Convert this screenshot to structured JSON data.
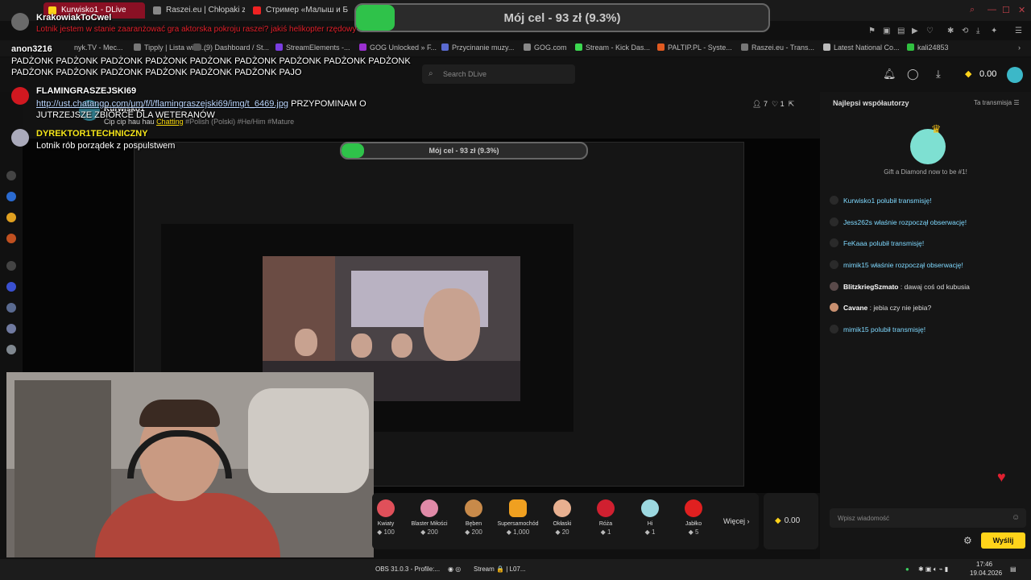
{
  "tabs": [
    {
      "label": "KrakowiakToCwel"
    },
    {
      "label": "Kurwisko1 - DLive"
    },
    {
      "label": "Raszei.eu | Chłopaki z Ra"
    },
    {
      "label": "Стример «Малыш и Бриг"
    }
  ],
  "bookmarks": [
    "nyk.TV - Mec...",
    "Tipply | Lista wiad...",
    "(9) Dashboard / St...",
    "StreamElements -...",
    "GOG Unlocked » F...",
    "Przycinanie muzy...",
    "GOG.com",
    "Stream - Kick Das...",
    "PALTIP.PL - Syste...",
    "Raszei.eu - Trans...",
    "Latest National Co...",
    "kali24853"
  ],
  "goal": {
    "label": "Mój cel - 93 zł (9.3%)",
    "progress": 0.093
  },
  "header": {
    "search_placeholder": "Search DLive",
    "balance": "0.00"
  },
  "stream": {
    "streamer": "Kurwisko1",
    "title": "Cip cip hau hau",
    "category": "Chatting",
    "tags": "#Polish (Polski) #He/Him #Mature",
    "viewers": "7",
    "likes": "1"
  },
  "overlay": [
    {
      "user": "KrakowiakToCwel",
      "msg": "Lotnik jestem w stanie zaaranżować gra aktorska pokroju raszei? jakiś helikopter rzędowy"
    },
    {
      "user": "anon3216",
      "msg": "PADŻONK PADŻONK PADŻONK PADŻONK PADŻONK PADŻONK PADŻONK PADŻONK PADŻONK PADŻONK PADŻONK PADŻONK PADŻONK PADŻONK PADŻONK PAJO"
    },
    {
      "user": "FLAMINGRASZEJSKI69",
      "link": "http://ust.chatango.com/um/f/l/flamingraszejski69/img/t_6469.jpg",
      "msg": "PRZYPOMINAM O JUTRZEJSZE ZBIÓRCE DLA WETERANÓW"
    },
    {
      "user": "DYREKTOR1TECHNICZNY",
      "msg": "Lotnik rób porządek z pospulstwem"
    }
  ],
  "gifts": [
    {
      "name": "Kwiaty",
      "value": "100",
      "color": "#e0505a"
    },
    {
      "name": "Blaster Miłości",
      "value": "200",
      "color": "#e08aa8"
    },
    {
      "name": "Bęben",
      "value": "200",
      "color": "#c88a4a"
    },
    {
      "name": "Supersamochód",
      "value": "1,000",
      "color": "#f0a020"
    },
    {
      "name": "Okłaski",
      "value": "20",
      "color": "#e8b090"
    },
    {
      "name": "Róża",
      "value": "1",
      "color": "#d02030"
    },
    {
      "name": "Hi",
      "value": "1",
      "color": "#9cd8e0"
    },
    {
      "name": "Jabłko",
      "value": "5",
      "color": "#e02020"
    }
  ],
  "more_label": "Więcej",
  "wallet": "0.00",
  "panel": {
    "title": "Najlepsi współautorzy",
    "link": "Ta transmisja",
    "diamond_text": "Gift a Diamond now to be #1!",
    "feed": [
      {
        "name": "Kurwisko1",
        "text": "polubił transmisję!",
        "system": true
      },
      {
        "name": "Jess262s",
        "text": "właśnie rozpoczął obserwację!",
        "system": true
      },
      {
        "name": "FeKaaa",
        "text": "polubił transmisję!",
        "system": true
      },
      {
        "name": "mimik15",
        "text": "właśnie rozpoczął obserwację!",
        "system": true
      },
      {
        "name": "BlitzkriegSzmato",
        "text": ": dawaj coś od kubusia",
        "system": false
      },
      {
        "name": "Cavane",
        "text": ": jebia czy nie jebia?",
        "system": false
      },
      {
        "name": "mimik15",
        "text": "polubił transmisję!",
        "system": true
      }
    ],
    "input_placeholder": "Wpisz wiadomość",
    "send_label": "Wyślij"
  },
  "taskbar": {
    "obs": "OBS 31.0.3 - Profile:...",
    "stream": "Stream 🔒 | L07...",
    "time": "17:46",
    "date": "19.04.2026"
  }
}
